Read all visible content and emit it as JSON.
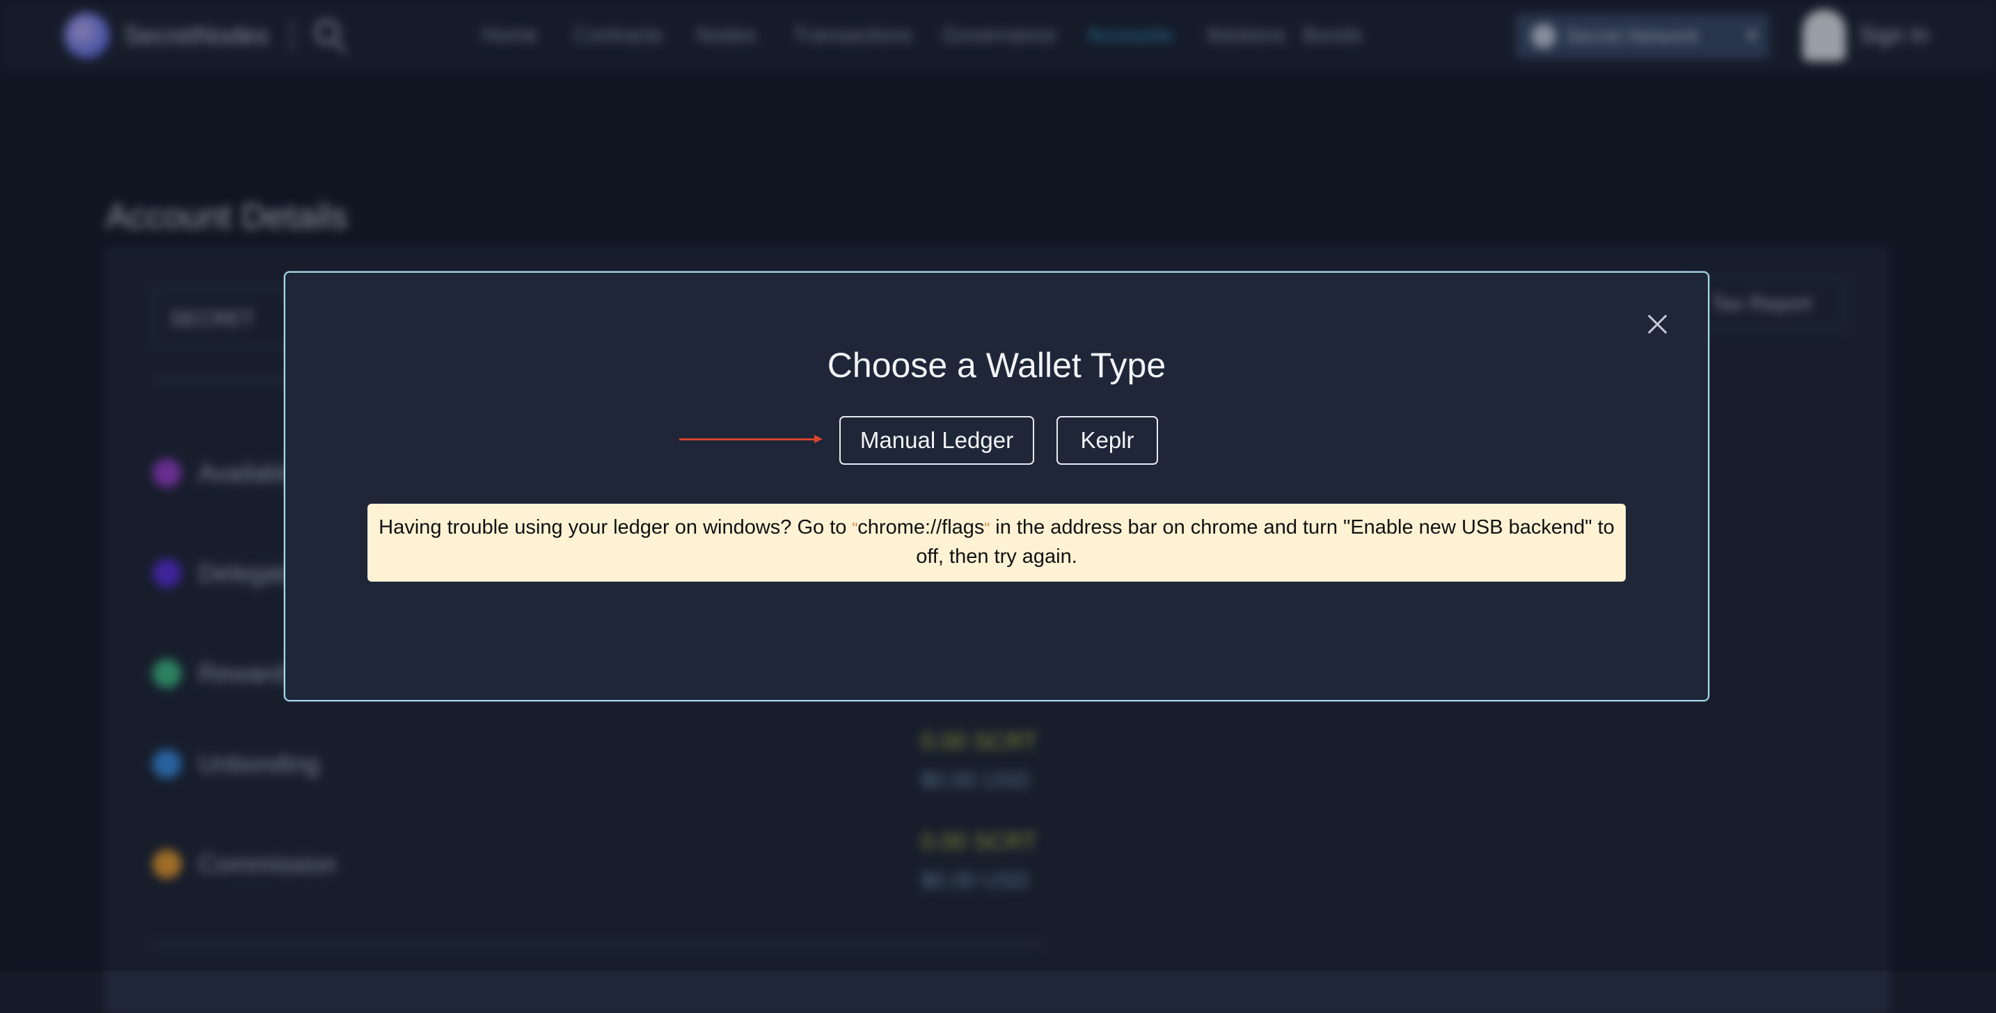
{
  "navbar": {
    "brand": "SecretNodes",
    "links": [
      "Home",
      "Contracts",
      "Nodes",
      "Transactions",
      "Governance",
      "Accounts",
      "Ibtokens",
      "Bonds"
    ],
    "active_link": "Accounts",
    "network": "Secret Network",
    "signin": "Sign In"
  },
  "page": {
    "title": "Account Details",
    "address_prefix": "SECRET",
    "tax_button": "Tax Report",
    "balances": [
      {
        "label": "Available",
        "amount": "",
        "usd": "",
        "color": "#9b3fd0"
      },
      {
        "label": "Delegated",
        "amount": "",
        "usd": "",
        "color": "#5b2ee0"
      },
      {
        "label": "Rewards",
        "amount": "",
        "usd": "",
        "color": "#3fbf8a"
      },
      {
        "label": "Unbonding",
        "amount": "0.00 SCRT",
        "usd": "$0.00 USD",
        "color": "#3a8ee6"
      },
      {
        "label": "Commission",
        "amount": "0.00 SCRT",
        "usd": "$0.00 USD",
        "color": "#f0a030"
      }
    ]
  },
  "modal": {
    "title": "Choose a Wallet Type",
    "buttons": {
      "manual_ledger": "Manual Ledger",
      "keplr": "Keplr"
    },
    "notice": {
      "before": "Having trouble using your ledger on windows? Go to ",
      "code": "chrome://flags",
      "after": " in the address bar on chrome and turn \"Enable new USB backend\" to off, then try again."
    }
  },
  "colors": {
    "modal_border": "#9fdde6",
    "notice_bg": "#fdf2d4",
    "arrow": "#d8452c",
    "accent": "#3ba4d8"
  }
}
